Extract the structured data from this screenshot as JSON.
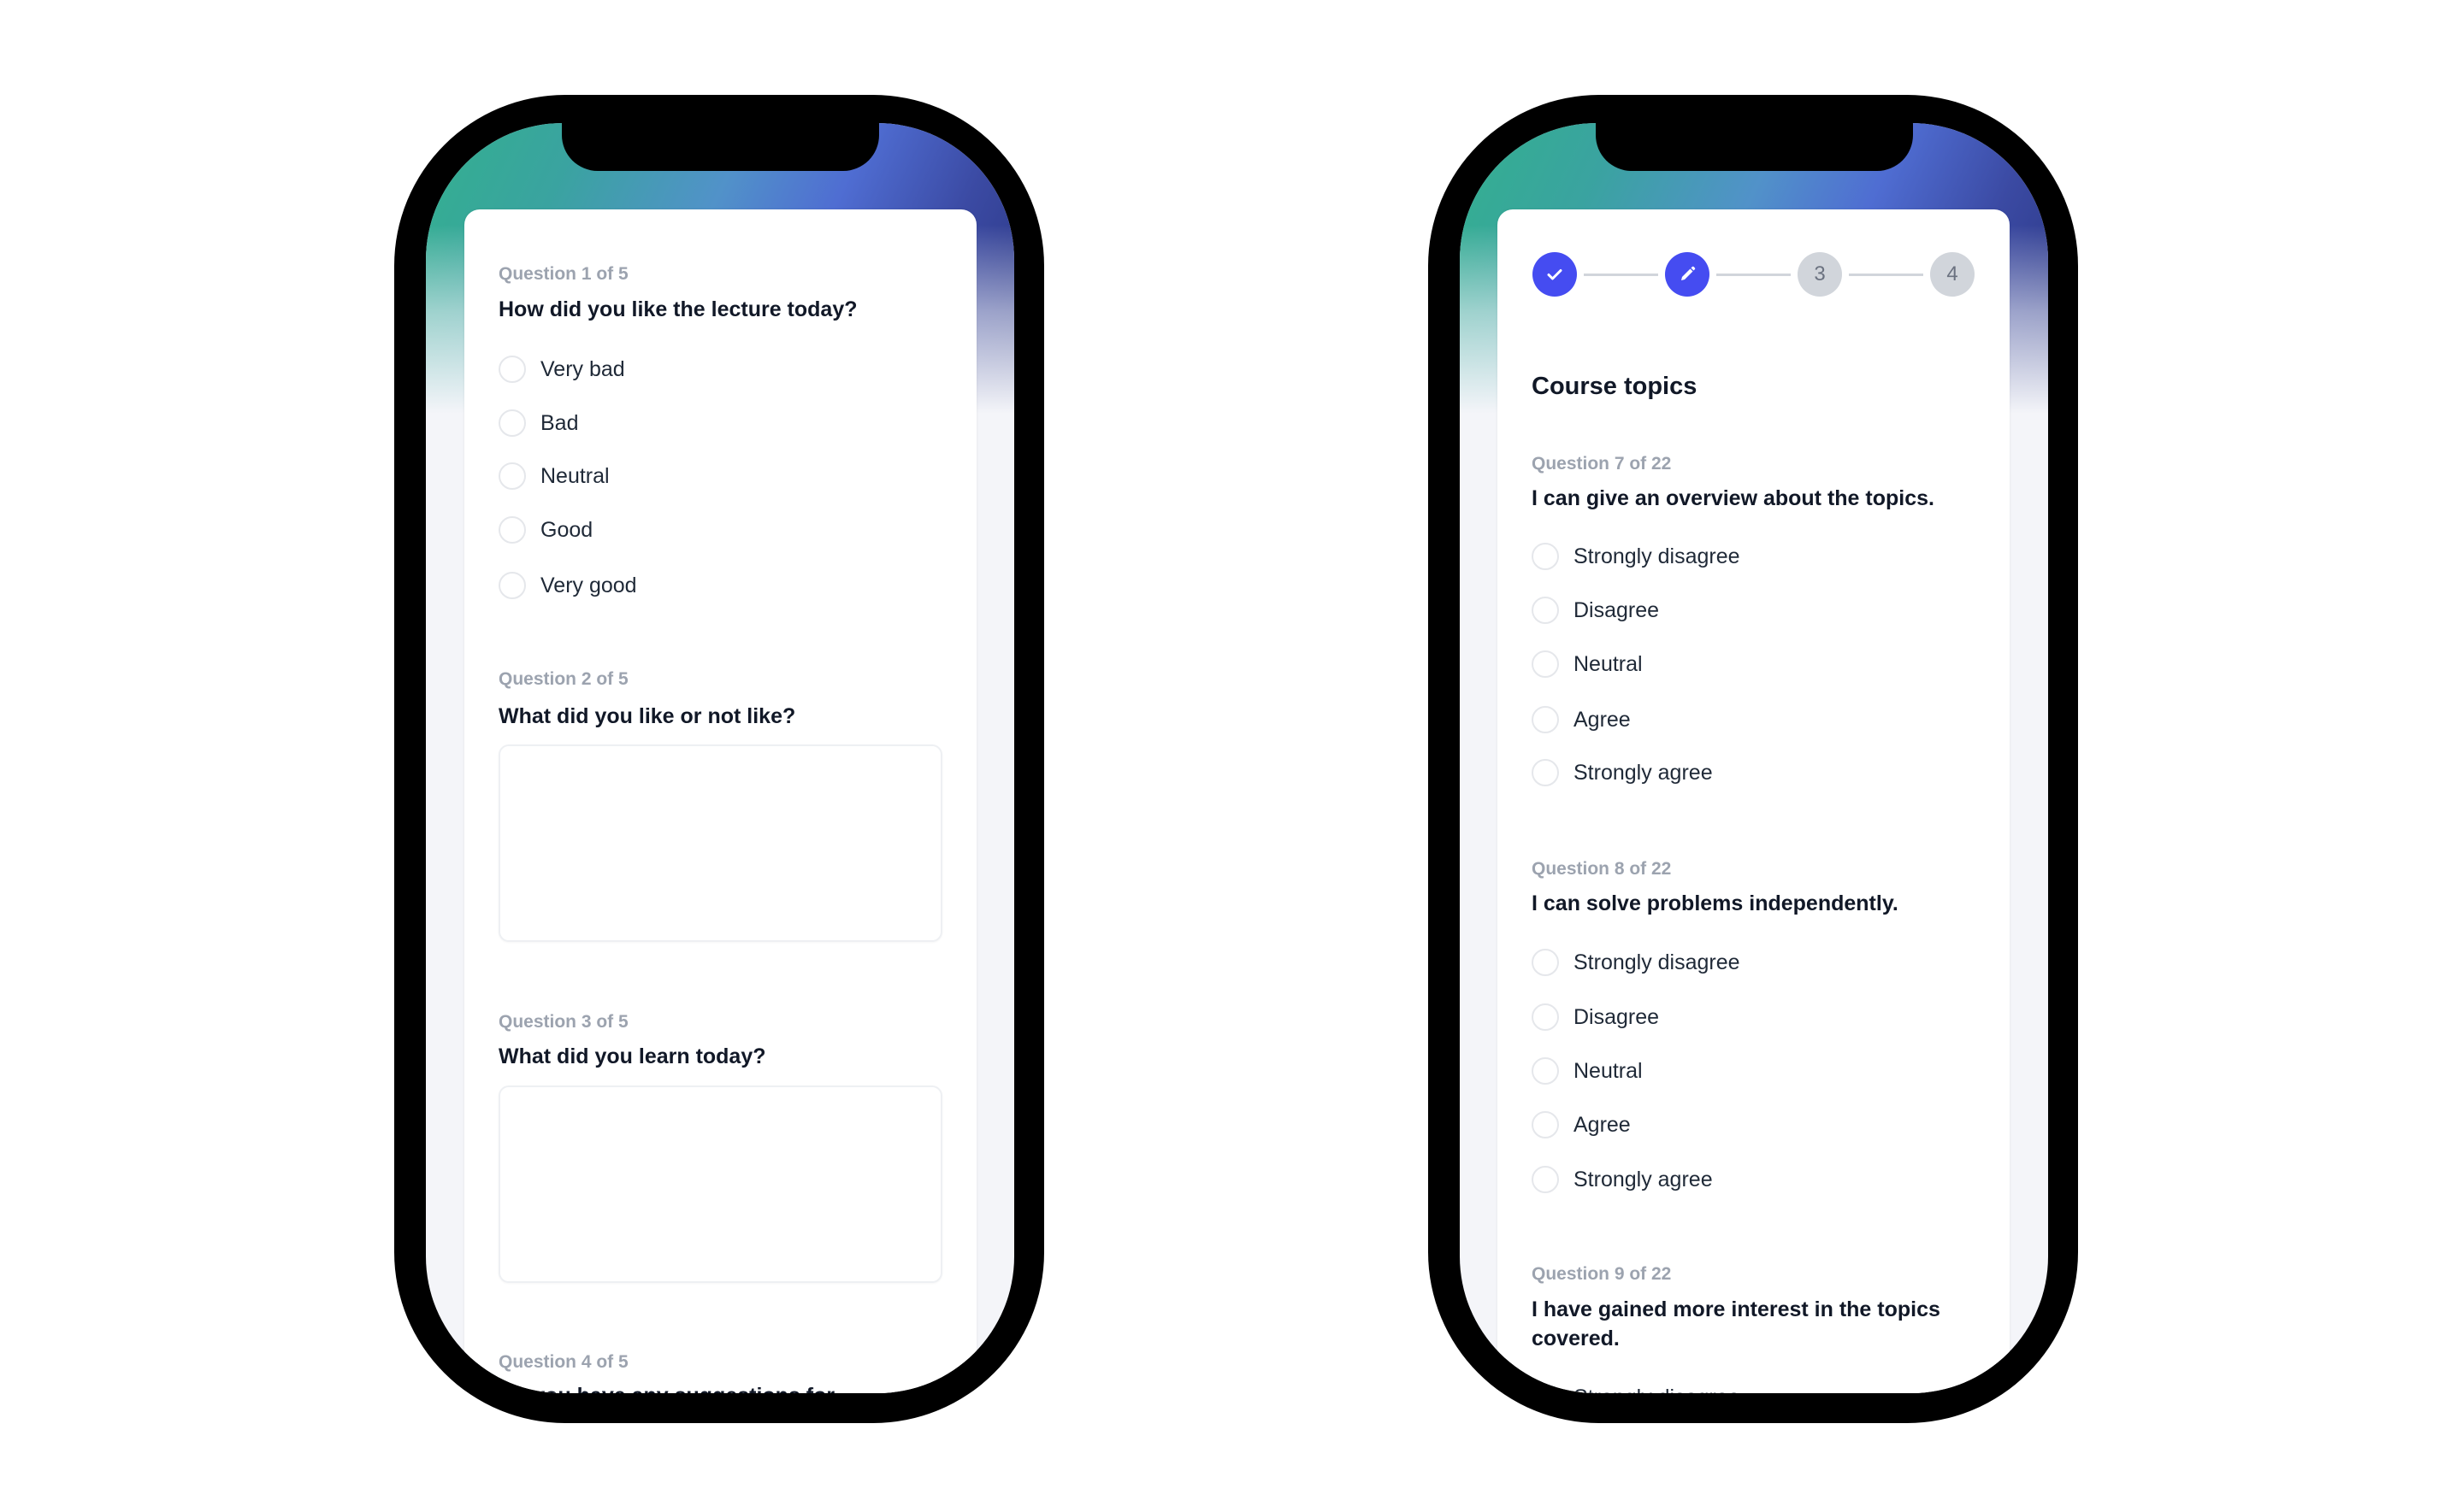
{
  "colors": {
    "accent": "#454cf1",
    "step_inactive": "#d1d5db",
    "label_gray": "#9ca3af",
    "text_dark": "#111827",
    "gradient": [
      "#33b08f",
      "#5192c9",
      "#4f6dd2",
      "#283480"
    ]
  },
  "left_phone": {
    "questions": [
      {
        "label": "Question 1 of 5",
        "text": "How did you like the lecture today?",
        "type": "radio",
        "options": [
          "Very bad",
          "Bad",
          "Neutral",
          "Good",
          "Very good"
        ]
      },
      {
        "label": "Question 2 of 5",
        "text": "What did you like or not like?",
        "type": "textarea",
        "value": ""
      },
      {
        "label": "Question 3 of 5",
        "text": "What did you learn today?",
        "type": "textarea",
        "value": ""
      },
      {
        "label": "Question 4 of 5",
        "text": "Do you have any suggestions for"
      }
    ]
  },
  "right_phone": {
    "stepper": [
      {
        "state": "done",
        "icon": "check-icon",
        "label": ""
      },
      {
        "state": "current",
        "icon": "pencil-icon",
        "label": ""
      },
      {
        "state": "todo",
        "label": "3"
      },
      {
        "state": "todo",
        "label": "4"
      }
    ],
    "section_title": "Course topics",
    "questions": [
      {
        "label": "Question 7 of 22",
        "text": "I can give an overview about the topics.",
        "options": [
          "Strongly disagree",
          "Disagree",
          "Neutral",
          "Agree",
          "Strongly agree"
        ]
      },
      {
        "label": "Question 8 of 22",
        "text": "I can solve problems independently.",
        "options": [
          "Strongly disagree",
          "Disagree",
          "Neutral",
          "Agree",
          "Strongly agree"
        ]
      },
      {
        "label": "Question 9 of 22",
        "text": "I have gained more interest in the topics covered.",
        "options": [
          "Strongly disagree"
        ]
      }
    ]
  }
}
